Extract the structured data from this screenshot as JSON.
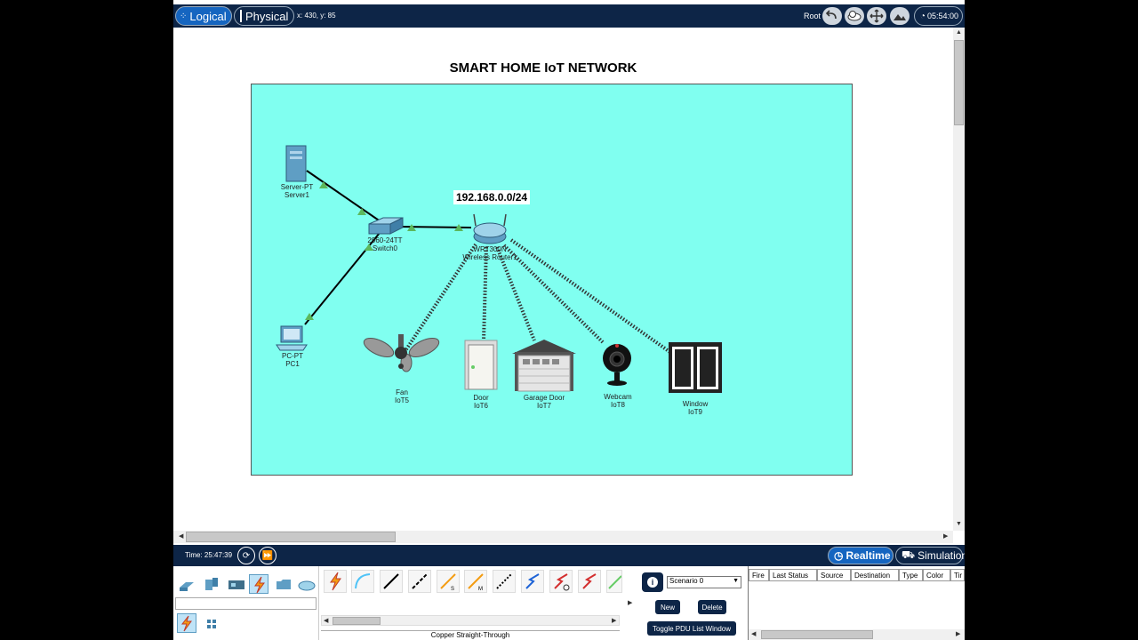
{
  "topbar": {
    "logical_label": "Logical",
    "physical_label": "Physical",
    "coords": "x: 430, y: 85",
    "root_label": "Root",
    "time": "05:54:00"
  },
  "workspace": {
    "title": "SMART HOME IoT NETWORK",
    "network_label": "192.168.0.0/24",
    "devices": {
      "server": {
        "model": "Server-PT",
        "name": "Server1"
      },
      "switch": {
        "model": "2960-24TT",
        "name": "Switch0"
      },
      "router": {
        "model": "WRT300N",
        "name": "Wireless Router1"
      },
      "pc": {
        "model": "PC-PT",
        "name": "PC1"
      },
      "fan": {
        "model": "Fan",
        "name": "IoT5"
      },
      "door": {
        "model": "Door",
        "name": "IoT6"
      },
      "garage": {
        "model": "Garage Door",
        "name": "IoT7"
      },
      "webcam": {
        "model": "Webcam",
        "name": "IoT8"
      },
      "window": {
        "model": "Window",
        "name": "IoT9"
      }
    }
  },
  "bottombar": {
    "time_label": "Time: 25:47:39",
    "realtime_label": "Realtime",
    "simulation_label": "Simulation"
  },
  "pdu": {
    "scenario": "Scenario 0",
    "new_label": "New",
    "delete_label": "Delete",
    "toggle_label": "Toggle PDU List Window"
  },
  "pdu_table": {
    "columns": [
      "Fire",
      "Last Status",
      "Source",
      "Destination",
      "Type",
      "Color",
      "Tir"
    ]
  },
  "cables": {
    "selected_name": "Copper Straight-Through",
    "letters": {
      "s": "S",
      "m": "M"
    }
  },
  "colors": {
    "navy": "#0d2547",
    "active_blue": "#1565c0",
    "cluster": "#80fff0",
    "link_up": "#5cb85c"
  }
}
